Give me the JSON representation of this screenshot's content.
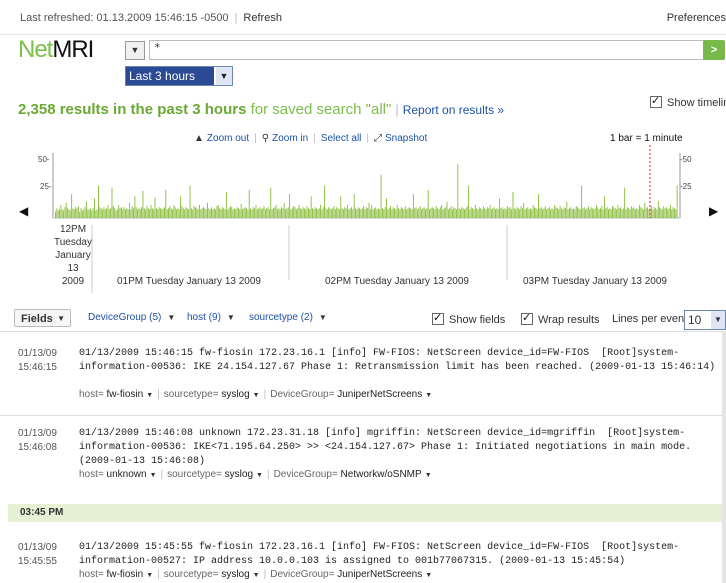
{
  "topbar": {
    "last_refreshed": "Last refreshed: 01.13.2009 15:46:15 -0500",
    "refresh": "Refresh",
    "preferences": "Preferences"
  },
  "logo": {
    "part1": "Net",
    "part2": "MRI"
  },
  "search": {
    "value": "*",
    "go_label": ">",
    "time_range": "Last 3 hours"
  },
  "results": {
    "count": "2,358 results in the past 3 hours",
    "suffix": " for saved search \"all\"",
    "report_link": "Report on results »",
    "show_timeline": "Show timeline"
  },
  "timeline_toolbar": {
    "zoom_out": "Zoom out",
    "zoom_in": "Zoom in",
    "select_all": "Select all",
    "snapshot": "Snapshot",
    "bar_scale": "1 bar = 1 minute"
  },
  "chart_data": {
    "type": "bar",
    "y_ticks": [
      "50-",
      "25-"
    ],
    "y_ticks_right": [
      "-50",
      "-25"
    ],
    "ylim": [
      0,
      60
    ],
    "x_labels": [
      "12PM\nTuesday\nJanuary\n13\n2009",
      "01PM Tuesday January 13 2009",
      "02PM Tuesday January 13 2009",
      "03PM Tuesday January 13 2009"
    ],
    "values": [
      6,
      9,
      7,
      8,
      12,
      8,
      7,
      10,
      14,
      9,
      8,
      7,
      22,
      9,
      8,
      10,
      9,
      11,
      6,
      9,
      7,
      8,
      10,
      15,
      8,
      8,
      9,
      7,
      9,
      18,
      7,
      8,
      30,
      10,
      9,
      8,
      10,
      8,
      9,
      12,
      8,
      9,
      28,
      11,
      9,
      7,
      8,
      12,
      9,
      10,
      8,
      10,
      8,
      9,
      8,
      14,
      8,
      11,
      9,
      20,
      10,
      8,
      9,
      8,
      10,
      25,
      9,
      8,
      11,
      9,
      8,
      12,
      9,
      8,
      19,
      9,
      8,
      10,
      9,
      8,
      9,
      10,
      26,
      8,
      9,
      11,
      9,
      8,
      12,
      10,
      8,
      9,
      8,
      20,
      11,
      9,
      8,
      10,
      9,
      8,
      30,
      9,
      8,
      11,
      10,
      9,
      8,
      12,
      8,
      9,
      10,
      9,
      8,
      14,
      9,
      8,
      10,
      8,
      9,
      8,
      11,
      12,
      9,
      8,
      10,
      9,
      8,
      24,
      8,
      9,
      11,
      10,
      8,
      9,
      8,
      10,
      9,
      8,
      13,
      8,
      9,
      10,
      9,
      8,
      26,
      9,
      8,
      10,
      9,
      12,
      8,
      9,
      10,
      8,
      9,
      11,
      8,
      9,
      10,
      8,
      28,
      8,
      9,
      10,
      12,
      8,
      9,
      8,
      10,
      9,
      14,
      8,
      9,
      10,
      22,
      8,
      9,
      11,
      10,
      8,
      9,
      12,
      9,
      8,
      10,
      9,
      8,
      11,
      9,
      8,
      20,
      9,
      8,
      10,
      9,
      8,
      9,
      12,
      8,
      10,
      30,
      9,
      8,
      10,
      9,
      8,
      9,
      11,
      8,
      10,
      9,
      8,
      20,
      9,
      8,
      10,
      9,
      12,
      8,
      9,
      10,
      8,
      22,
      9,
      8,
      10,
      9,
      8,
      9,
      11,
      8,
      10,
      9,
      14,
      8,
      12,
      8,
      9,
      10,
      8,
      9,
      8,
      40,
      9,
      8,
      10,
      18,
      8,
      9,
      11,
      8,
      10,
      9,
      8,
      12,
      9,
      8,
      10,
      9,
      8,
      11,
      8,
      9,
      10,
      9,
      8,
      22,
      9,
      10,
      8,
      9,
      11,
      8,
      9,
      10,
      8,
      9,
      26,
      8,
      9,
      10,
      9,
      8,
      11,
      9,
      8,
      10,
      12,
      8,
      9,
      10,
      15,
      8,
      9,
      11,
      8,
      10,
      9,
      8,
      50,
      9,
      8,
      10,
      9,
      8,
      9,
      11,
      30,
      8,
      10,
      9,
      8,
      12,
      9,
      8,
      10,
      9,
      8,
      11,
      9,
      8,
      10,
      9,
      12,
      8,
      9,
      10,
      8,
      9,
      8,
      18,
      9,
      10,
      8,
      9,
      8,
      11,
      9,
      10,
      8,
      24,
      9,
      8,
      10,
      9,
      8,
      11,
      9,
      14,
      8,
      9,
      10,
      8,
      9,
      8,
      12,
      10,
      9,
      8,
      22,
      9,
      10,
      8,
      9,
      11,
      8,
      9,
      10,
      8,
      9,
      8,
      12,
      10,
      9,
      8,
      11,
      9,
      8,
      10,
      9,
      15,
      8,
      9,
      10,
      8,
      9,
      8,
      11,
      10,
      9,
      8,
      30,
      9,
      10,
      8,
      9,
      11,
      8,
      10,
      9,
      8,
      9,
      12,
      10,
      8,
      9,
      11,
      8,
      20,
      9,
      10,
      8,
      9,
      8,
      11,
      10,
      9,
      8,
      12,
      9,
      10,
      8,
      9,
      28,
      8,
      10,
      9,
      8,
      11,
      9,
      10,
      8,
      9,
      8,
      12,
      10,
      9,
      8,
      14,
      9,
      10,
      8,
      9,
      11,
      8,
      10,
      9,
      8,
      16,
      10,
      9,
      8,
      11,
      9,
      10,
      8,
      9,
      12,
      8,
      10,
      9,
      8,
      30
    ]
  },
  "fields_bar": {
    "fields_label": "Fields",
    "tabs": [
      {
        "label": "DeviceGroup (5)"
      },
      {
        "label": "host (9)"
      },
      {
        "label": "sourcetype (2)"
      }
    ],
    "show_fields": "Show fields",
    "wrap_results": "Wrap results",
    "lines_per_event": "Lines per event:",
    "lines_value": "10"
  },
  "events": [
    {
      "date": "01/13/09",
      "time": "15:46:15",
      "raw": "01/13/2009 15:46:15 fw-fiosin 172.23.16.1 [info] FW-FIOS: NetScreen device_id=FW-FIOS  [Root]system-information-00536: IKE 24.154.127.67 Phase 1: Retransmission limit has been reached. (2009-01-13 15:46:14)",
      "host": "fw-fiosin",
      "sourcetype": "syslog",
      "devicegroup": "JuniperNetScreens"
    },
    {
      "date": "01/13/09",
      "time": "15:46:08",
      "raw": "01/13/2009 15:46:08 unknown 172.23.31.18 [info] mgriffin: NetScreen device_id=mgriffin  [Root]system-information-00536: IKE<71.195.64.250> >> <24.154.127.67> Phase 1: Initiated negotiations in main mode. (2009-01-13 15:46:08)",
      "host": "unknown",
      "sourcetype": "syslog",
      "devicegroup": "Networkw/oSNMP"
    },
    {
      "date": "01/13/09",
      "time": "15:45:55",
      "raw": "01/13/2009 15:45:55 fw-fiosin 172.23.16.1 [info] FW-FIOS: NetScreen device_id=FW-FIOS  [Root]system-information-00527: IP address 10.0.0.103 is assigned to 001b77067315. (2009-01-13 15:45:54)",
      "host": "fw-fiosin",
      "sourcetype": "syslog",
      "devicegroup": "JuniperNetScreens"
    }
  ],
  "meta_keys": {
    "host": "host=",
    "sourcetype": "sourcetype=",
    "devicegroup": "DeviceGroup="
  },
  "time_band": "03:45 PM"
}
